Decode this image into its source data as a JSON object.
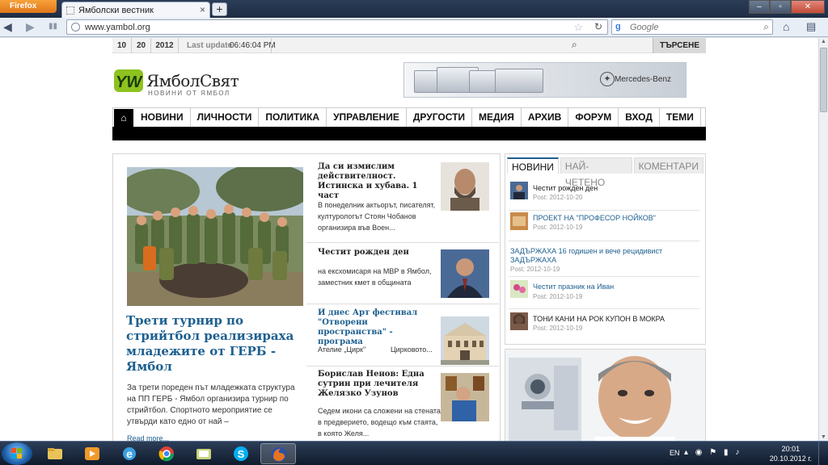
{
  "browser": {
    "app_button": "Firefox",
    "tab_title": "Ямболски вестник",
    "new_tab": "+",
    "url": "www.yambol.org",
    "search_placeholder": "Google"
  },
  "site": {
    "date": {
      "day": "10",
      "month": "20",
      "year": "2012"
    },
    "last_update_label": "Last update",
    "last_update_time": "06:46:04 PM",
    "search_button": "ТЪРСЕНЕ",
    "logo": {
      "mark": "YW",
      "name": "ЯмболСвят",
      "subtitle": "НОВИНИ ОТ ЯМБОЛ"
    },
    "banner_brand": "Mercedes-Benz",
    "nav": [
      "НОВИНИ",
      "ЛИЧНОСТИ",
      "ПОЛИТИКА",
      "УПРАВЛЕНИЕ",
      "ДРУГОСТИ",
      "МЕДИЯ",
      "АРХИВ",
      "ФОРУМ",
      "ВХОД",
      "ТЕМИ"
    ]
  },
  "featured": {
    "title": "Трети турнир по стрийтбол реализираха младежите от ГЕРБ - Ямбол",
    "text": "За трети пореден път младежката структура на ПП ГЕРБ - Ямбол организира турнир по стрийтбол. Спортното мероприятие се утвърди като едно от най –",
    "more": "Read more..."
  },
  "articles": [
    {
      "title": "Да си измислим действителност. Истинска и хубава. 1 част",
      "text": "В понеделник актьорът, писателят, културологът Стоян Чобанов организира във Воен..."
    },
    {
      "title": "Честит рожден ден",
      "text": "на ексхомисаря на МВР в Ямбол, заместник кмет в общината"
    },
    {
      "title": "И днес Арт фестивал \"Отворени пространства\" - програма",
      "text_left": "Ателие „Цирк\"",
      "text_right": "Цирковото..."
    },
    {
      "title": "Борислав Ненов: Една сутрин при лечителя Желязко Узунов",
      "text": "Седем икони са сложени на стената в предверието, водещо към стаята, в която Желя..."
    }
  ],
  "sidebar": {
    "tabs": [
      "НОВИНИ",
      "НАЙ-ЧЕТЕНО",
      "КОМЕНТАРИ"
    ],
    "items": [
      {
        "title": "Честит рожден ден",
        "date": "Post: 2012-10-20",
        "color": "#1a1a1a"
      },
      {
        "title": "ПРОЕКТ НА \"ПРОФЕСОР НОЙКОВ\"",
        "date": "Post: 2012-10-19",
        "color": "#1d5f8f"
      },
      {
        "title": "ЗАДЪРЖАХА 16 годишен и вече рецидивист ЗАДЪРЖАХА",
        "date": "Post: 2012-10-19",
        "color": "#1d5f8f"
      },
      {
        "title": "Честит празник на Иван",
        "date": "Post: 2012-10-19",
        "color": "#1d5f8f"
      },
      {
        "title": "ТОНИ КАНИ НА РОК КУПОН В МОКРА",
        "date": "Post: 2012-10-19",
        "color": "#1a1a1a"
      }
    ]
  },
  "taskbar": {
    "lang": "EN",
    "time": "20:01",
    "date": "20.10.2012 г."
  },
  "colors": {
    "link": "#1d5f8f",
    "nav_black": "#000000",
    "logo_green": "#8dc21f"
  }
}
